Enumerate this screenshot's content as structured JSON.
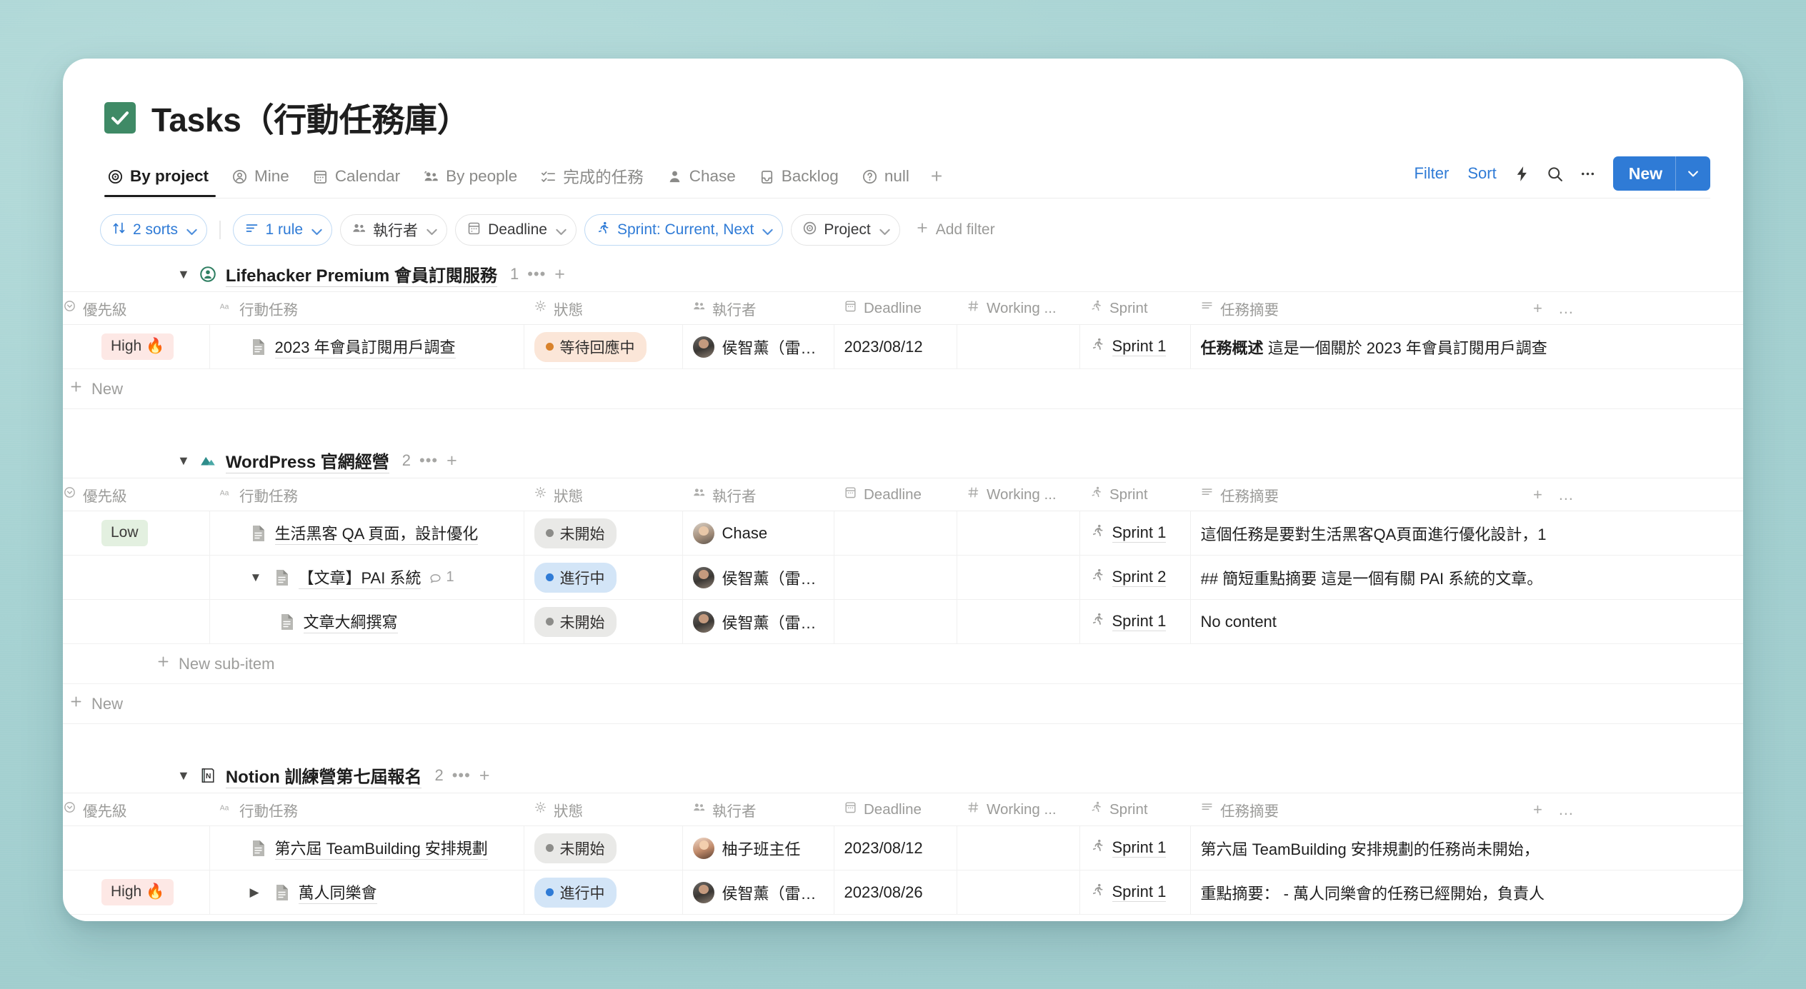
{
  "window": {
    "title": "Tasks（行動任務庫）",
    "title_icon": "green-checkbox-icon"
  },
  "tabs": [
    {
      "label": "By project",
      "icon": "target-icon",
      "active": true
    },
    {
      "label": "Mine",
      "icon": "person-circle-icon",
      "active": false
    },
    {
      "label": "Calendar",
      "icon": "calendar-icon",
      "active": false
    },
    {
      "label": "By people",
      "icon": "people-icon",
      "active": false
    },
    {
      "label": "完成的任務",
      "icon": "checklist-icon",
      "active": false
    },
    {
      "label": "Chase",
      "icon": "person-icon",
      "active": false
    },
    {
      "label": "Backlog",
      "icon": "inbox-icon",
      "active": false
    },
    {
      "label": "null",
      "icon": "question-circle-icon",
      "active": false
    }
  ],
  "tab_add_label": "+",
  "toolbar": {
    "filter_label": "Filter",
    "sort_label": "Sort",
    "lightning_icon": "lightning-icon",
    "search_icon": "search-icon",
    "more_icon": "ellipsis-icon",
    "new_label": "New",
    "new_chevron_icon": "chevron-down-icon",
    "accent_color": "#2f7bd6"
  },
  "filterbar": {
    "sorts": {
      "label": "2 sorts",
      "icon": "sort-arrows-icon"
    },
    "rule": {
      "label": "1 rule",
      "icon": "filter-lines-icon"
    },
    "chips": [
      {
        "label": "執行者",
        "icon": "people-icon",
        "active": false
      },
      {
        "label": "Deadline",
        "icon": "calendar-icon",
        "active": false
      },
      {
        "label": "Sprint: Current, Next",
        "icon": "runner-icon",
        "active": true
      },
      {
        "label": "Project",
        "icon": "target-icon",
        "active": false
      }
    ],
    "add_filter": "Add filter"
  },
  "columns": [
    {
      "label": "優先級",
      "icon": "chevron-circle-icon"
    },
    {
      "label": "行動任務",
      "icon": "aa-icon"
    },
    {
      "label": "狀態",
      "icon": "status-burst-icon"
    },
    {
      "label": "執行者",
      "icon": "people-icon"
    },
    {
      "label": "Deadline",
      "icon": "calendar-icon"
    },
    {
      "label": "Working ...",
      "icon": "hash-icon"
    },
    {
      "label": "Sprint",
      "icon": "runner-icon"
    },
    {
      "label": "任務摘要",
      "icon": "text-lines-icon"
    }
  ],
  "column_actions": {
    "add": "+",
    "more": "…"
  },
  "new_row_label": "New",
  "new_sub_item_label": "New sub-item",
  "groups": [
    {
      "name": "Lifehacker Premium 會員訂閱服務",
      "icon": "person-badge-icon",
      "count": "1",
      "rows": [
        {
          "priority": "High",
          "priority_emoji": "🔥",
          "priority_style": "high",
          "indent": 0,
          "caret": "none",
          "name": "2023 年會員訂閱用戶調查",
          "comments": "",
          "status": "等待回應中",
          "status_style": "wait",
          "assignee": "侯智薰（雷蒙）",
          "avatar": "av-a",
          "deadline": "2023/08/12",
          "working": "",
          "sprint": "Sprint 1",
          "summary_bold": "任務概述",
          "summary": "這是一個關於 2023 年會員訂閱用戶調查"
        }
      ]
    },
    {
      "name": "WordPress 官網經營",
      "icon": "mountain-icon",
      "count": "2",
      "rows": [
        {
          "priority": "Low",
          "priority_emoji": "",
          "priority_style": "low",
          "indent": 0,
          "caret": "none",
          "name": "生活黑客 QA 頁面，設計優化",
          "comments": "",
          "status": "未開始",
          "status_style": "not",
          "assignee": "Chase",
          "avatar": "av-b",
          "deadline": "",
          "working": "",
          "sprint": "Sprint 1",
          "summary_bold": "",
          "summary": "這個任務是要對生活黑客QA頁面進行優化設計，1"
        },
        {
          "priority": "",
          "priority_emoji": "",
          "priority_style": "",
          "indent": 1,
          "caret": "down",
          "name": "【文章】PAI 系統",
          "comments": "1",
          "status": "進行中",
          "status_style": "prog",
          "assignee": "侯智薰（雷蒙）",
          "avatar": "av-a",
          "deadline": "",
          "working": "",
          "sprint": "Sprint 2",
          "summary_bold": "",
          "summary": "## 簡短重點摘要 這是一個有關 PAI 系統的文章。"
        },
        {
          "priority": "",
          "priority_emoji": "",
          "priority_style": "",
          "indent": 2,
          "caret": "none",
          "name": "文章大綱撰寫",
          "comments": "",
          "status": "未開始",
          "status_style": "not",
          "assignee": "侯智薰（雷蒙）",
          "avatar": "av-a",
          "deadline": "",
          "working": "",
          "sprint": "Sprint 1",
          "summary_bold": "",
          "summary": "No content"
        }
      ],
      "has_new_sub_item": true
    },
    {
      "name": "Notion 訓練營第七屆報名",
      "icon": "notion-book-icon",
      "count": "2",
      "rows": [
        {
          "priority": "",
          "priority_emoji": "",
          "priority_style": "",
          "indent": 1,
          "caret": "none",
          "name": "第六屆 TeamBuilding 安排規劃",
          "comments": "",
          "status": "未開始",
          "status_style": "not",
          "assignee": "柚子班主任",
          "avatar": "av-c",
          "deadline": "2023/08/12",
          "working": "",
          "sprint": "Sprint 1",
          "summary_bold": "",
          "summary": "第六屆 TeamBuilding 安排規劃的任務尚未開始，"
        },
        {
          "priority": "High",
          "priority_emoji": "🔥",
          "priority_style": "high",
          "indent": 1,
          "caret": "right",
          "name": "萬人同樂會",
          "comments": "",
          "status": "進行中",
          "status_style": "prog",
          "assignee": "侯智薰（雷蒙）",
          "avatar": "av-a",
          "deadline": "2023/08/26",
          "working": "",
          "sprint": "Sprint 1",
          "summary_bold": "",
          "summary": "重點摘要： - 萬人同樂會的任務已經開始，負責人"
        }
      ]
    }
  ],
  "colors": {
    "background": "#a8d2d2",
    "accent_blue": "#2f7bd6",
    "status_wait_bg": "#fbe6d8",
    "status_not_bg": "#e9e9e7",
    "status_progress_bg": "#d3e5f7",
    "priority_high_bg": "#fde8e5",
    "priority_low_bg": "#e3f0e0",
    "title_icon_bg": "#3f8a66"
  }
}
